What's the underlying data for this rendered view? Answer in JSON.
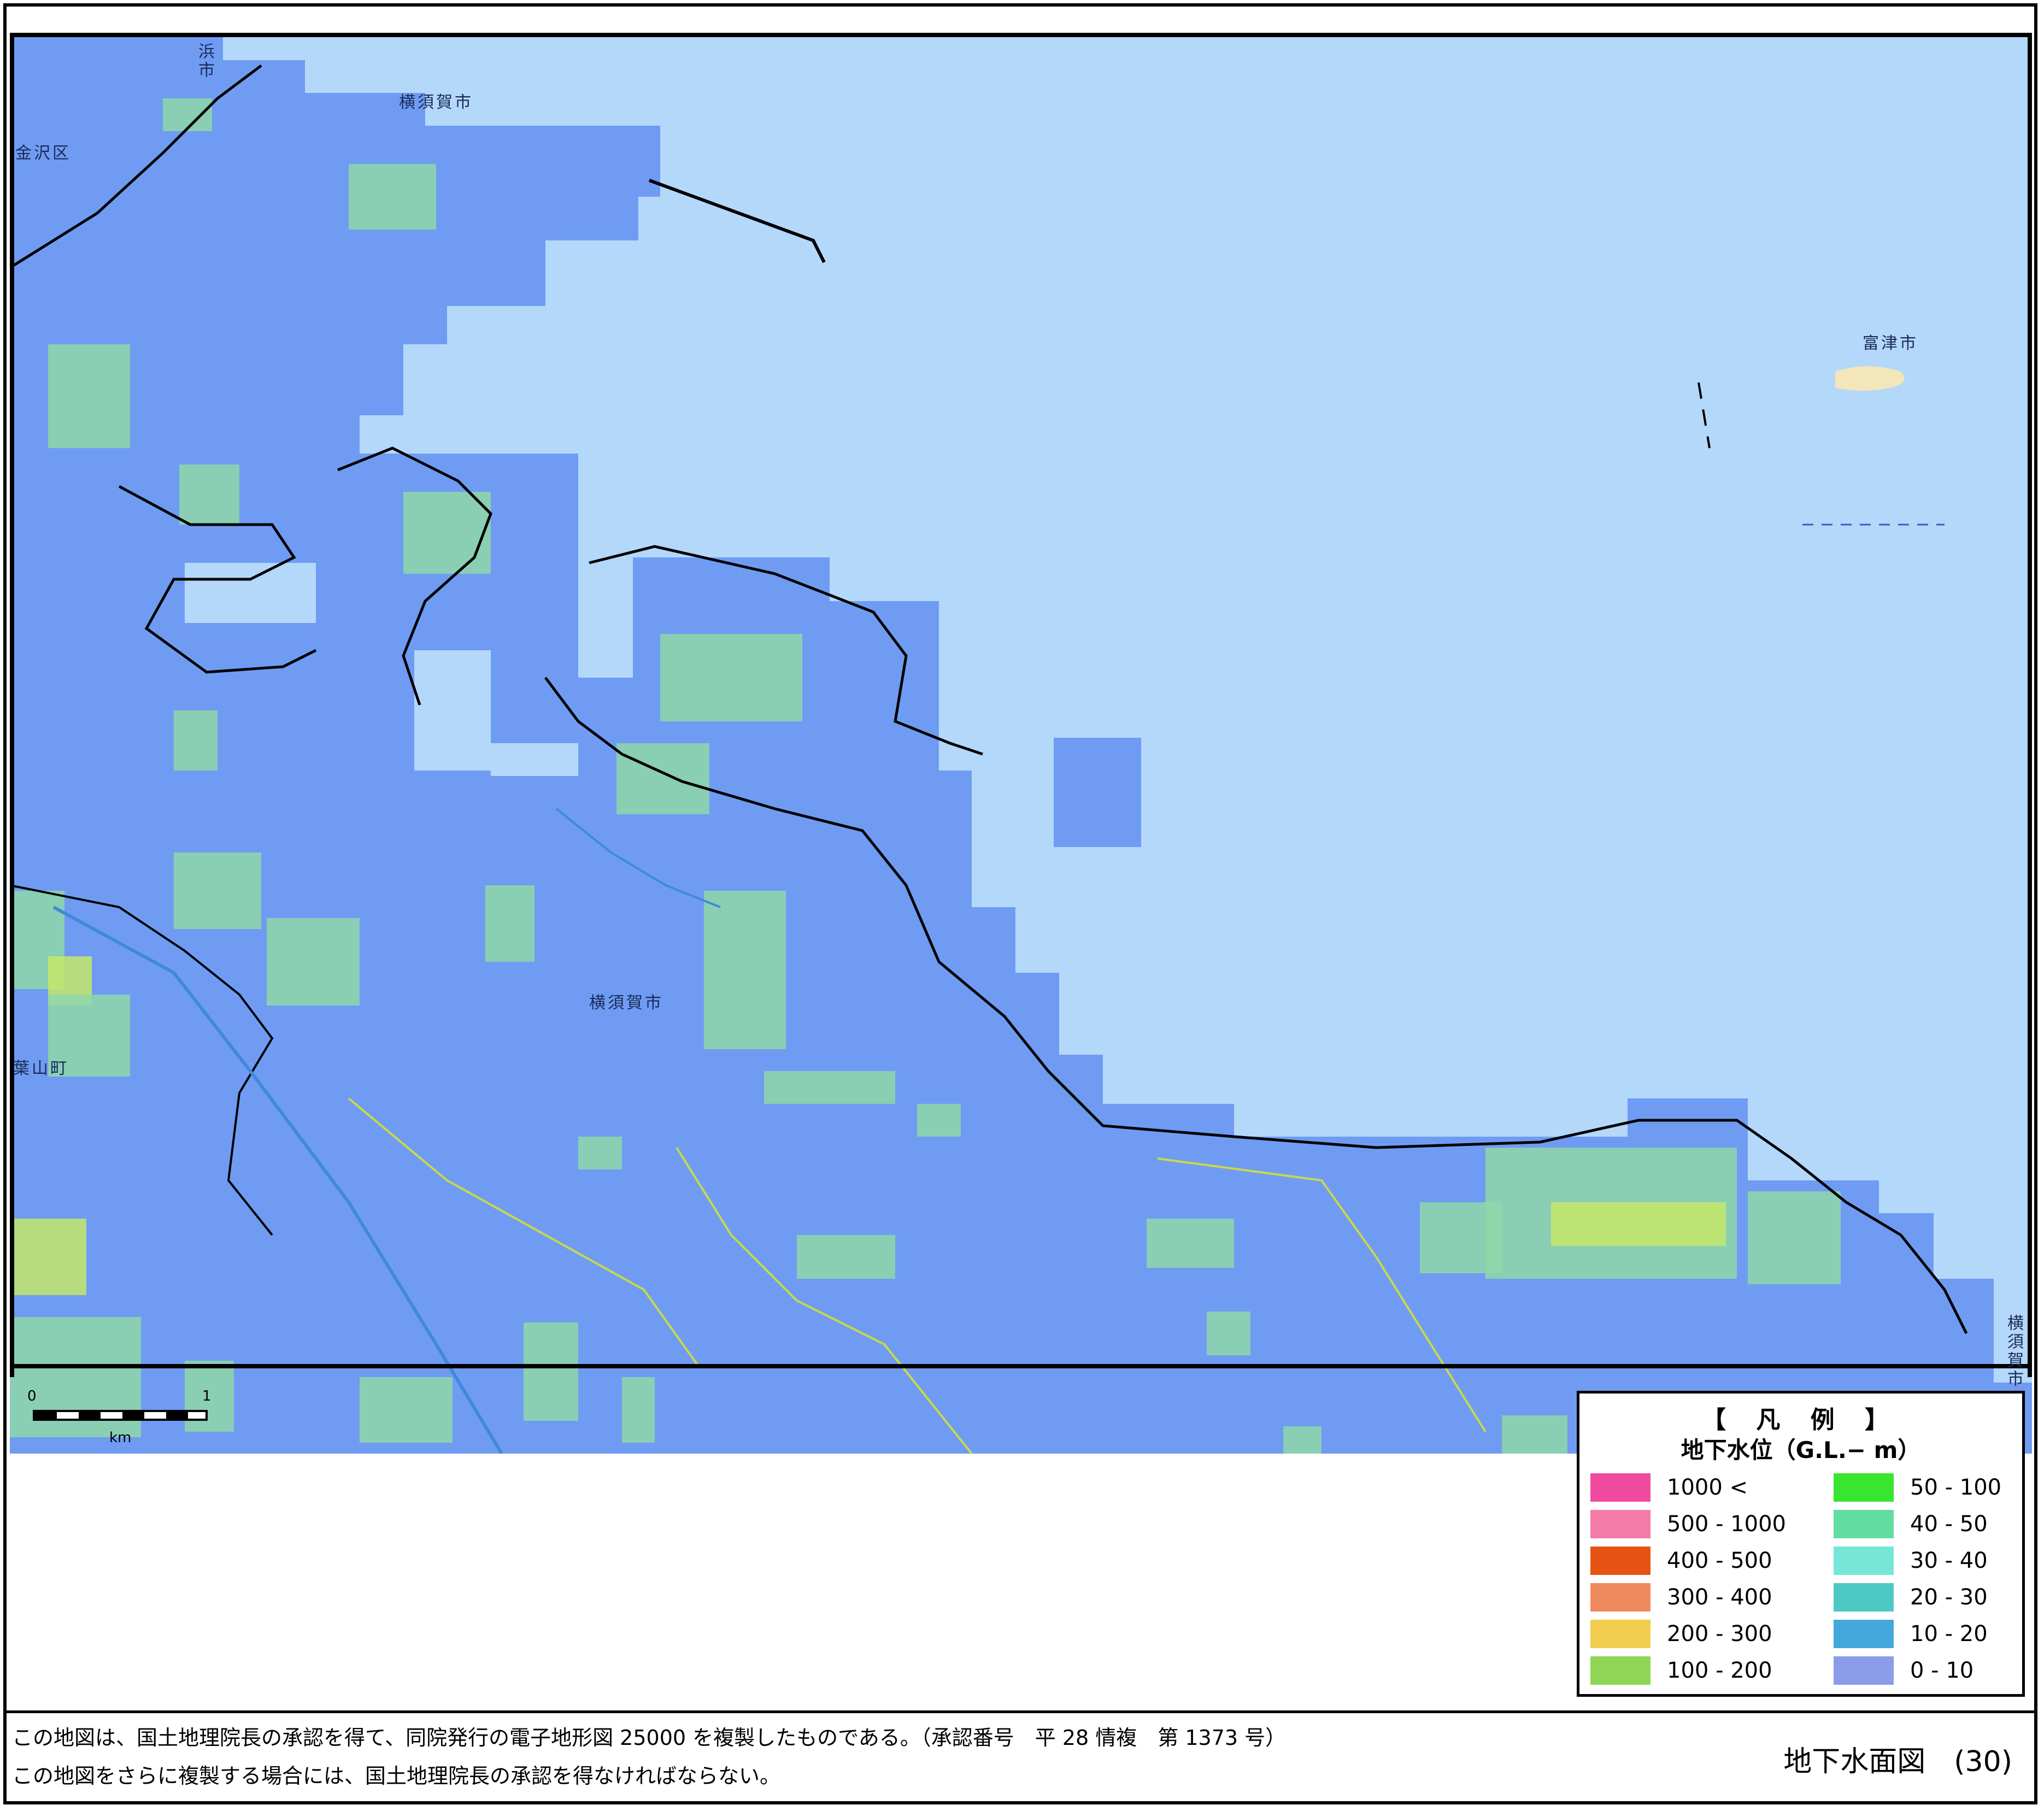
{
  "map": {
    "water_color": "#b4d8fa",
    "land_color": "#6f9cf2",
    "grid_colors": {
      "light_green": "#8fd7a8",
      "yellow_green": "#c3e86a",
      "pale": "#c9e2f8"
    },
    "labels": {
      "yokohama": "浜市",
      "kanazawa": "金沢区",
      "yokosuka_north": "横須賀市",
      "futtsu": "富津市",
      "yokosuka_center": "横須賀市",
      "hayama": "葉山町",
      "yokosuka_east": "横須賀市"
    }
  },
  "scale": {
    "zero": "0",
    "one": "1",
    "unit": "km"
  },
  "legend": {
    "title": "【 凡 例 】",
    "subtitle": "地下水位（G.L.− m）",
    "items": [
      {
        "label": "1000 <",
        "color": "#f04aa0"
      },
      {
        "label": "500 - 1000",
        "color": "#f47aa8"
      },
      {
        "label": "400 - 500",
        "color": "#e55412"
      },
      {
        "label": "300 - 400",
        "color": "#ef8a5e"
      },
      {
        "label": "200 - 300",
        "color": "#f2cd4e"
      },
      {
        "label": "100 - 200",
        "color": "#8fd655"
      },
      {
        "label": "50 - 100",
        "color": "#38e62f"
      },
      {
        "label": "40 - 50",
        "color": "#63dca0"
      },
      {
        "label": "30 - 40",
        "color": "#75e6d7"
      },
      {
        "label": "20 - 30",
        "color": "#4ec8c4"
      },
      {
        "label": "10 - 20",
        "color": "#45a8dc"
      },
      {
        "label": "0 - 10",
        "color": "#8b9ce8"
      }
    ]
  },
  "footer": {
    "line1": "この地図は、国土地理院長の承認を得て、同院発行の電子地形図 25000 を複製したものである。（承認番号　平 28 情複　第 1373 号）",
    "line2": "この地図をさらに複製する場合には、国土地理院長の承認を得なければならない。",
    "title": "地下水面図　(30)"
  }
}
